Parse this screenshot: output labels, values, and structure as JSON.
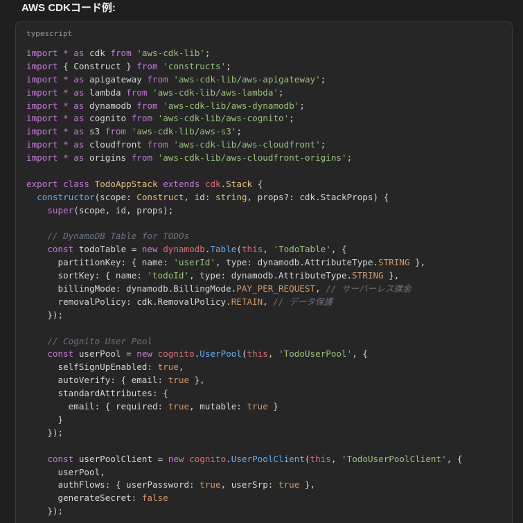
{
  "heading": "AWS CDKコード例:",
  "code_block": {
    "language": "typescript",
    "lines": [
      [
        [
          "keyword",
          "import"
        ],
        [
          "plain",
          " "
        ],
        [
          "keyword",
          "*"
        ],
        [
          "plain",
          " "
        ],
        [
          "keyword",
          "as"
        ],
        [
          "plain",
          " cdk "
        ],
        [
          "keyword",
          "from"
        ],
        [
          "plain",
          " "
        ],
        [
          "string",
          "'aws-cdk-lib'"
        ],
        [
          "plain",
          ";"
        ]
      ],
      [
        [
          "keyword",
          "import"
        ],
        [
          "plain",
          " { Construct } "
        ],
        [
          "keyword",
          "from"
        ],
        [
          "plain",
          " "
        ],
        [
          "string",
          "'constructs'"
        ],
        [
          "plain",
          ";"
        ]
      ],
      [
        [
          "keyword",
          "import"
        ],
        [
          "plain",
          " "
        ],
        [
          "keyword",
          "*"
        ],
        [
          "plain",
          " "
        ],
        [
          "keyword",
          "as"
        ],
        [
          "plain",
          " apigateway "
        ],
        [
          "keyword",
          "from"
        ],
        [
          "plain",
          " "
        ],
        [
          "string",
          "'aws-cdk-lib/aws-apigateway'"
        ],
        [
          "plain",
          ";"
        ]
      ],
      [
        [
          "keyword",
          "import"
        ],
        [
          "plain",
          " "
        ],
        [
          "keyword",
          "*"
        ],
        [
          "plain",
          " "
        ],
        [
          "keyword",
          "as"
        ],
        [
          "plain",
          " lambda "
        ],
        [
          "keyword",
          "from"
        ],
        [
          "plain",
          " "
        ],
        [
          "string",
          "'aws-cdk-lib/aws-lambda'"
        ],
        [
          "plain",
          ";"
        ]
      ],
      [
        [
          "keyword",
          "import"
        ],
        [
          "plain",
          " "
        ],
        [
          "keyword",
          "*"
        ],
        [
          "plain",
          " "
        ],
        [
          "keyword",
          "as"
        ],
        [
          "plain",
          " dynamodb "
        ],
        [
          "keyword",
          "from"
        ],
        [
          "plain",
          " "
        ],
        [
          "string",
          "'aws-cdk-lib/aws-dynamodb'"
        ],
        [
          "plain",
          ";"
        ]
      ],
      [
        [
          "keyword",
          "import"
        ],
        [
          "plain",
          " "
        ],
        [
          "keyword",
          "*"
        ],
        [
          "plain",
          " "
        ],
        [
          "keyword",
          "as"
        ],
        [
          "plain",
          " cognito "
        ],
        [
          "keyword",
          "from"
        ],
        [
          "plain",
          " "
        ],
        [
          "string",
          "'aws-cdk-lib/aws-cognito'"
        ],
        [
          "plain",
          ";"
        ]
      ],
      [
        [
          "keyword",
          "import"
        ],
        [
          "plain",
          " "
        ],
        [
          "keyword",
          "*"
        ],
        [
          "plain",
          " "
        ],
        [
          "keyword",
          "as"
        ],
        [
          "plain",
          " s3 "
        ],
        [
          "keyword",
          "from"
        ],
        [
          "plain",
          " "
        ],
        [
          "string",
          "'aws-cdk-lib/aws-s3'"
        ],
        [
          "plain",
          ";"
        ]
      ],
      [
        [
          "keyword",
          "import"
        ],
        [
          "plain",
          " "
        ],
        [
          "keyword",
          "*"
        ],
        [
          "plain",
          " "
        ],
        [
          "keyword",
          "as"
        ],
        [
          "plain",
          " cloudfront "
        ],
        [
          "keyword",
          "from"
        ],
        [
          "plain",
          " "
        ],
        [
          "string",
          "'aws-cdk-lib/aws-cloudfront'"
        ],
        [
          "plain",
          ";"
        ]
      ],
      [
        [
          "keyword",
          "import"
        ],
        [
          "plain",
          " "
        ],
        [
          "keyword",
          "*"
        ],
        [
          "plain",
          " "
        ],
        [
          "keyword",
          "as"
        ],
        [
          "plain",
          " origins "
        ],
        [
          "keyword",
          "from"
        ],
        [
          "plain",
          " "
        ],
        [
          "string",
          "'aws-cdk-lib/aws-cloudfront-origins'"
        ],
        [
          "plain",
          ";"
        ]
      ],
      [],
      [
        [
          "keyword",
          "export"
        ],
        [
          "plain",
          " "
        ],
        [
          "keyword",
          "class"
        ],
        [
          "plain",
          " "
        ],
        [
          "class",
          "TodoAppStack"
        ],
        [
          "plain",
          " "
        ],
        [
          "keyword",
          "extends"
        ],
        [
          "plain",
          " "
        ],
        [
          "namespace",
          "cdk"
        ],
        [
          "plain",
          "."
        ],
        [
          "class",
          "Stack"
        ],
        [
          "plain",
          " {"
        ]
      ],
      [
        [
          "plain",
          "  "
        ],
        [
          "func",
          "constructor"
        ],
        [
          "plain",
          "(scope: "
        ],
        [
          "type",
          "Construct"
        ],
        [
          "plain",
          ", id: "
        ],
        [
          "type",
          "string"
        ],
        [
          "plain",
          ", props?: cdk.StackProps) {"
        ]
      ],
      [
        [
          "plain",
          "    "
        ],
        [
          "keyword",
          "super"
        ],
        [
          "plain",
          "(scope, id, props);"
        ]
      ],
      [],
      [
        [
          "plain",
          "    "
        ],
        [
          "comment",
          "// DynamoDB Table for TODOs"
        ]
      ],
      [
        [
          "plain",
          "    "
        ],
        [
          "keyword",
          "const"
        ],
        [
          "plain",
          " todoTable = "
        ],
        [
          "keyword",
          "new"
        ],
        [
          "plain",
          " "
        ],
        [
          "namespace",
          "dynamodb"
        ],
        [
          "plain",
          "."
        ],
        [
          "func",
          "Table"
        ],
        [
          "plain",
          "("
        ],
        [
          "builtin",
          "this"
        ],
        [
          "plain",
          ", "
        ],
        [
          "string",
          "'TodoTable'"
        ],
        [
          "plain",
          ", {"
        ]
      ],
      [
        [
          "plain",
          "      partitionKey: { name: "
        ],
        [
          "string",
          "'userId'"
        ],
        [
          "plain",
          ", type: dynamodb.AttributeType."
        ],
        [
          "const",
          "STRING"
        ],
        [
          "plain",
          " },"
        ]
      ],
      [
        [
          "plain",
          "      sortKey: { name: "
        ],
        [
          "string",
          "'todoId'"
        ],
        [
          "plain",
          ", type: dynamodb.AttributeType."
        ],
        [
          "const",
          "STRING"
        ],
        [
          "plain",
          " },"
        ]
      ],
      [
        [
          "plain",
          "      billingMode: dynamodb.BillingMode."
        ],
        [
          "const",
          "PAY_PER_REQUEST"
        ],
        [
          "plain",
          ", "
        ],
        [
          "comment",
          "// サーバーレス課金"
        ]
      ],
      [
        [
          "plain",
          "      removalPolicy: cdk.RemovalPolicy."
        ],
        [
          "const",
          "RETAIN"
        ],
        [
          "plain",
          ", "
        ],
        [
          "comment",
          "// データ保護"
        ]
      ],
      [
        [
          "plain",
          "    });"
        ]
      ],
      [],
      [
        [
          "plain",
          "    "
        ],
        [
          "comment",
          "// Cognito User Pool"
        ]
      ],
      [
        [
          "plain",
          "    "
        ],
        [
          "keyword",
          "const"
        ],
        [
          "plain",
          " userPool = "
        ],
        [
          "keyword",
          "new"
        ],
        [
          "plain",
          " "
        ],
        [
          "namespace",
          "cognito"
        ],
        [
          "plain",
          "."
        ],
        [
          "func",
          "UserPool"
        ],
        [
          "plain",
          "("
        ],
        [
          "builtin",
          "this"
        ],
        [
          "plain",
          ", "
        ],
        [
          "string",
          "'TodoUserPool'"
        ],
        [
          "plain",
          ", {"
        ]
      ],
      [
        [
          "plain",
          "      selfSignUpEnabled: "
        ],
        [
          "bool",
          "true"
        ],
        [
          "plain",
          ","
        ]
      ],
      [
        [
          "plain",
          "      autoVerify: { email: "
        ],
        [
          "bool",
          "true"
        ],
        [
          "plain",
          " },"
        ]
      ],
      [
        [
          "plain",
          "      standardAttributes: {"
        ]
      ],
      [
        [
          "plain",
          "        email: { required: "
        ],
        [
          "bool",
          "true"
        ],
        [
          "plain",
          ", mutable: "
        ],
        [
          "bool",
          "true"
        ],
        [
          "plain",
          " }"
        ]
      ],
      [
        [
          "plain",
          "      }"
        ]
      ],
      [
        [
          "plain",
          "    });"
        ]
      ],
      [],
      [
        [
          "plain",
          "    "
        ],
        [
          "keyword",
          "const"
        ],
        [
          "plain",
          " userPoolClient = "
        ],
        [
          "keyword",
          "new"
        ],
        [
          "plain",
          " "
        ],
        [
          "namespace",
          "cognito"
        ],
        [
          "plain",
          "."
        ],
        [
          "func",
          "UserPoolClient"
        ],
        [
          "plain",
          "("
        ],
        [
          "builtin",
          "this"
        ],
        [
          "plain",
          ", "
        ],
        [
          "string",
          "'TodoUserPoolClient'"
        ],
        [
          "plain",
          ", {"
        ]
      ],
      [
        [
          "plain",
          "      userPool,"
        ]
      ],
      [
        [
          "plain",
          "      authFlows: { userPassword: "
        ],
        [
          "bool",
          "true"
        ],
        [
          "plain",
          ", userSrp: "
        ],
        [
          "bool",
          "true"
        ],
        [
          "plain",
          " },"
        ]
      ],
      [
        [
          "plain",
          "      generateSecret: "
        ],
        [
          "bool",
          "false"
        ]
      ],
      [
        [
          "plain",
          "    });"
        ]
      ]
    ]
  }
}
